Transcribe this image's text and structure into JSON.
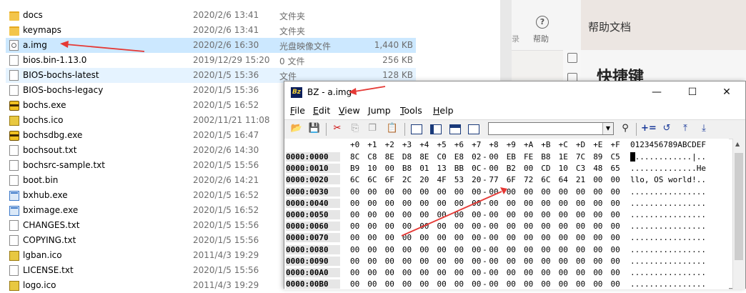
{
  "explorer": {
    "files": [
      {
        "name": "docs",
        "date": "2020/2/6 13:41",
        "type": "文件夹",
        "size": "",
        "icon": "folder-icon"
      },
      {
        "name": "keymaps",
        "date": "2020/2/6 13:41",
        "type": "文件夹",
        "size": "",
        "icon": "folder-icon"
      },
      {
        "name": "a.img",
        "date": "2020/2/6 16:30",
        "type": "光盘映像文件",
        "size": "1,440 KB",
        "icon": "disc-image-icon"
      },
      {
        "name": "bios.bin-1.13.0",
        "date": "2019/12/29 15:20",
        "type": "0 文件",
        "size": "256 KB",
        "icon": "file-icon"
      },
      {
        "name": "BIOS-bochs-latest",
        "date": "2020/1/5 15:36",
        "type": "文件",
        "size": "128 KB",
        "icon": "file-icon"
      },
      {
        "name": "BIOS-bochs-legacy",
        "date": "2020/1/5 15:36",
        "type": "",
        "size": "",
        "icon": "file-icon"
      },
      {
        "name": "bochs.exe",
        "date": "2020/1/5 16:52",
        "type": "",
        "size": "",
        "icon": "bochs-exe-icon"
      },
      {
        "name": "bochs.ico",
        "date": "2002/11/21 11:08",
        "type": "",
        "size": "",
        "icon": "ico-file-icon"
      },
      {
        "name": "bochsdbg.exe",
        "date": "2020/1/5 16:47",
        "type": "",
        "size": "",
        "icon": "bochs-exe-icon"
      },
      {
        "name": "bochsout.txt",
        "date": "2020/2/6 14:30",
        "type": "",
        "size": "",
        "icon": "text-file-icon"
      },
      {
        "name": "bochsrc-sample.txt",
        "date": "2020/1/5 15:56",
        "type": "",
        "size": "",
        "icon": "text-file-icon"
      },
      {
        "name": "boot.bin",
        "date": "2020/2/6 14:21",
        "type": "",
        "size": "",
        "icon": "file-icon"
      },
      {
        "name": "bxhub.exe",
        "date": "2020/1/5 16:52",
        "type": "",
        "size": "",
        "icon": "exe-icon"
      },
      {
        "name": "bximage.exe",
        "date": "2020/1/5 16:52",
        "type": "",
        "size": "",
        "icon": "exe-icon"
      },
      {
        "name": "CHANGES.txt",
        "date": "2020/1/5 15:56",
        "type": "",
        "size": "",
        "icon": "text-file-icon"
      },
      {
        "name": "COPYING.txt",
        "date": "2020/1/5 15:56",
        "type": "",
        "size": "",
        "icon": "text-file-icon"
      },
      {
        "name": "lgban.ico",
        "date": "2011/4/3 19:29",
        "type": "",
        "size": "",
        "icon": "ico-file-icon"
      },
      {
        "name": "LICENSE.txt",
        "date": "2020/1/5 15:56",
        "type": "",
        "size": "",
        "icon": "text-file-icon"
      },
      {
        "name": "logo.ico",
        "date": "2011/4/3 19:29",
        "type": "",
        "size": "",
        "icon": "ico-file-icon"
      }
    ]
  },
  "help_app": {
    "help_button_label": "帮助",
    "header_title": "帮助文档",
    "heading": "快捷键",
    "partial_label": "录"
  },
  "bz": {
    "title": "BZ - a.img",
    "app_icon_text": "Bz",
    "window_controls": {
      "minimize": "—",
      "maximize": "☐",
      "close": "✕"
    },
    "menu": [
      {
        "label": "File",
        "accel": "F",
        "rest": "ile"
      },
      {
        "label": "Edit",
        "accel": "E",
        "rest": "dit"
      },
      {
        "label": "View",
        "accel": "V",
        "rest": "iew"
      },
      {
        "label": "Jump",
        "accel": "J",
        "rest": "ump"
      },
      {
        "label": "Tools",
        "accel": "T",
        "rest": "ools"
      },
      {
        "label": "Help",
        "accel": "H",
        "rest": "elp"
      }
    ],
    "toolbar": {
      "combo_value": "",
      "icons": [
        "open-icon",
        "save-icon",
        "cut-icon",
        "copy-icon",
        "paste-icon",
        "view-single-icon",
        "view-split-vertical-icon",
        "view-split-horizontal-icon",
        "view-columns-icon",
        "find-icon",
        "increment-icon",
        "undo-icon",
        "jump-top-icon",
        "jump-bottom-icon"
      ]
    },
    "hex": {
      "header_cols": [
        "+0",
        "+1",
        "+2",
        "+3",
        "+4",
        "+5",
        "+6",
        "+7",
        "+8",
        "+9",
        "+A",
        "+B",
        "+C",
        "+D",
        "+E",
        "+F"
      ],
      "ascii_header": "0123456789ABCDEF",
      "rows": [
        {
          "addr": "0000:0000",
          "bytes": [
            "8C",
            "C8",
            "8E",
            "D8",
            "8E",
            "C0",
            "E8",
            "02",
            "00",
            "EB",
            "FE",
            "B8",
            "1E",
            "7C",
            "89",
            "C5"
          ],
          "ascii": ".............|.."
        },
        {
          "addr": "0000:0010",
          "bytes": [
            "B9",
            "10",
            "00",
            "B8",
            "01",
            "13",
            "BB",
            "0C",
            "00",
            "B2",
            "00",
            "CD",
            "10",
            "C3",
            "48",
            "65"
          ],
          "ascii": "..............He"
        },
        {
          "addr": "0000:0020",
          "bytes": [
            "6C",
            "6C",
            "6F",
            "2C",
            "20",
            "4F",
            "53",
            "20",
            "77",
            "6F",
            "72",
            "6C",
            "64",
            "21",
            "00",
            "00"
          ],
          "ascii": "llo, OS world!.."
        },
        {
          "addr": "0000:0030",
          "bytes": [
            "00",
            "00",
            "00",
            "00",
            "00",
            "00",
            "00",
            "00",
            "00",
            "00",
            "00",
            "00",
            "00",
            "00",
            "00",
            "00"
          ],
          "ascii": "................"
        },
        {
          "addr": "0000:0040",
          "bytes": [
            "00",
            "00",
            "00",
            "00",
            "00",
            "00",
            "00",
            "00",
            "00",
            "00",
            "00",
            "00",
            "00",
            "00",
            "00",
            "00"
          ],
          "ascii": "................"
        },
        {
          "addr": "0000:0050",
          "bytes": [
            "00",
            "00",
            "00",
            "00",
            "00",
            "00",
            "00",
            "00",
            "00",
            "00",
            "00",
            "00",
            "00",
            "00",
            "00",
            "00"
          ],
          "ascii": "................"
        },
        {
          "addr": "0000:0060",
          "bytes": [
            "00",
            "00",
            "00",
            "00",
            "00",
            "00",
            "00",
            "00",
            "00",
            "00",
            "00",
            "00",
            "00",
            "00",
            "00",
            "00"
          ],
          "ascii": "................"
        },
        {
          "addr": "0000:0070",
          "bytes": [
            "00",
            "00",
            "00",
            "00",
            "00",
            "00",
            "00",
            "00",
            "00",
            "00",
            "00",
            "00",
            "00",
            "00",
            "00",
            "00"
          ],
          "ascii": "................"
        },
        {
          "addr": "0000:0080",
          "bytes": [
            "00",
            "00",
            "00",
            "00",
            "00",
            "00",
            "00",
            "00",
            "00",
            "00",
            "00",
            "00",
            "00",
            "00",
            "00",
            "00"
          ],
          "ascii": "................"
        },
        {
          "addr": "0000:0090",
          "bytes": [
            "00",
            "00",
            "00",
            "00",
            "00",
            "00",
            "00",
            "00",
            "00",
            "00",
            "00",
            "00",
            "00",
            "00",
            "00",
            "00"
          ],
          "ascii": "................"
        },
        {
          "addr": "0000:00A0",
          "bytes": [
            "00",
            "00",
            "00",
            "00",
            "00",
            "00",
            "00",
            "00",
            "00",
            "00",
            "00",
            "00",
            "00",
            "00",
            "00",
            "00"
          ],
          "ascii": "................"
        },
        {
          "addr": "0000:00B0",
          "bytes": [
            "00",
            "00",
            "00",
            "00",
            "00",
            "00",
            "00",
            "00",
            "00",
            "00",
            "00",
            "00",
            "00",
            "00",
            "00",
            "00"
          ],
          "ascii": "................"
        }
      ]
    }
  },
  "colors": {
    "selection": "#cce8ff",
    "hover": "#e5f3ff",
    "arrow": "#e53935"
  }
}
